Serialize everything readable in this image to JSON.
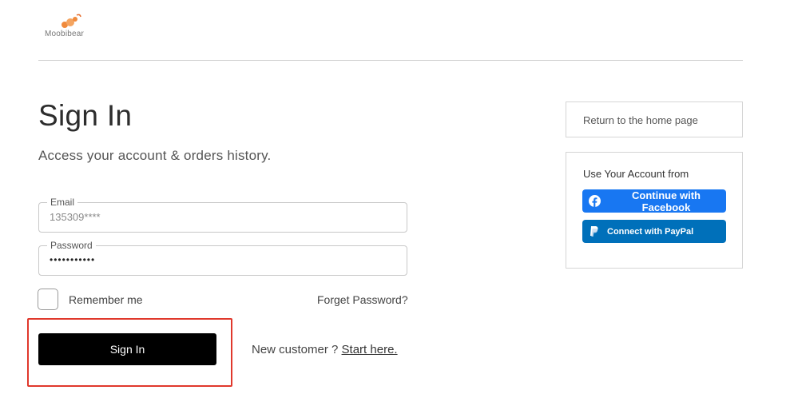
{
  "brand": {
    "name": "Moobibear",
    "accent_color": "#f08a3c"
  },
  "page": {
    "title": "Sign In",
    "subtitle": "Access your account & orders history."
  },
  "form": {
    "email_label": "Email",
    "email_value": "135309****",
    "password_label": "Password",
    "password_value": "•••••••••••",
    "remember_label": "Remember me",
    "forget_label": "Forget Password?",
    "submit_label": "Sign In",
    "new_customer_text": "New customer ?",
    "start_here_label": "Start here."
  },
  "sidebar": {
    "home_link": "Return to the home page",
    "social_title": "Use Your Account from",
    "facebook_label": "Continue with Facebook",
    "paypal_label": "Connect with PayPal"
  },
  "colors": {
    "facebook": "#1877f2",
    "paypal": "#0070ba",
    "highlight": "#e0382c"
  },
  "icons": {
    "facebook": "facebook-icon",
    "paypal": "paypal-icon",
    "logo": "bear-logo-icon"
  }
}
